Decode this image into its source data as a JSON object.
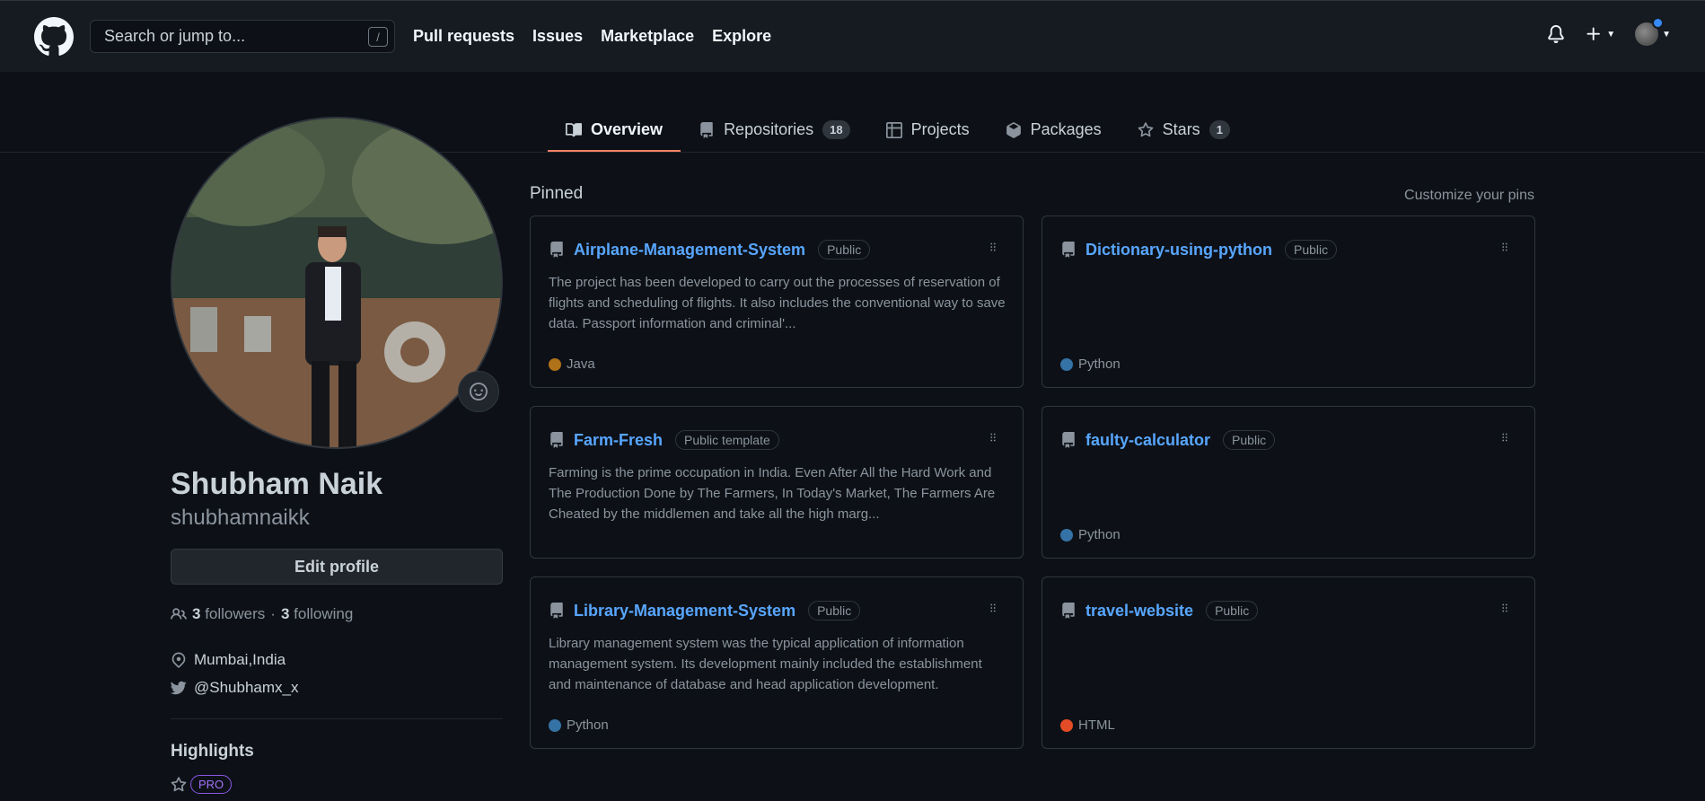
{
  "header": {
    "search_placeholder": "Search or jump to...",
    "search_key": "/",
    "nav": [
      "Pull requests",
      "Issues",
      "Marketplace",
      "Explore"
    ]
  },
  "tabs": [
    {
      "label": "Overview",
      "count": null,
      "icon": "book-icon"
    },
    {
      "label": "Repositories",
      "count": "18",
      "icon": "repo-icon"
    },
    {
      "label": "Projects",
      "count": null,
      "icon": "table-icon"
    },
    {
      "label": "Packages",
      "count": null,
      "icon": "package-icon"
    },
    {
      "label": "Stars",
      "count": "1",
      "icon": "star-icon"
    }
  ],
  "profile": {
    "fullname": "Shubham Naik",
    "username": "shubhamnaikk",
    "edit_label": "Edit profile",
    "followers_count": "3",
    "followers_label": "followers",
    "sep": "·",
    "following_count": "3",
    "following_label": "following",
    "location": "Mumbai,India",
    "twitter": "@Shubhamx_x",
    "highlights_title": "Highlights",
    "pro_label": "PRO"
  },
  "pinned": {
    "title": "Pinned",
    "customize": "Customize your pins",
    "repos": [
      {
        "name": "Airplane-Management-System",
        "visibility": "Public",
        "description": "The project has been developed to carry out the processes of reservation of flights and scheduling of flights. It also includes the conventional way to save data. Passport information and criminal'...",
        "language": "Java",
        "lang_color": "#b07219"
      },
      {
        "name": "Dictionary-using-python",
        "visibility": "Public",
        "description": "",
        "language": "Python",
        "lang_color": "#3572A5"
      },
      {
        "name": "Farm-Fresh",
        "visibility": "Public template",
        "description": "Farming is the prime occupation in India. Even After All the Hard Work and The Production Done by The Farmers, In Today's Market, The Farmers Are Cheated by the middlemen and take all the high marg...",
        "language": "",
        "lang_color": ""
      },
      {
        "name": "faulty-calculator",
        "visibility": "Public",
        "description": "",
        "language": "Python",
        "lang_color": "#3572A5"
      },
      {
        "name": "Library-Management-System",
        "visibility": "Public",
        "description": "Library management system was the typical application of information management system. Its development mainly included the establishment and maintenance of database and head application development.",
        "language": "Python",
        "lang_color": "#3572A5"
      },
      {
        "name": "travel-website",
        "visibility": "Public",
        "description": "",
        "language": "HTML",
        "lang_color": "#e34c26"
      }
    ]
  }
}
